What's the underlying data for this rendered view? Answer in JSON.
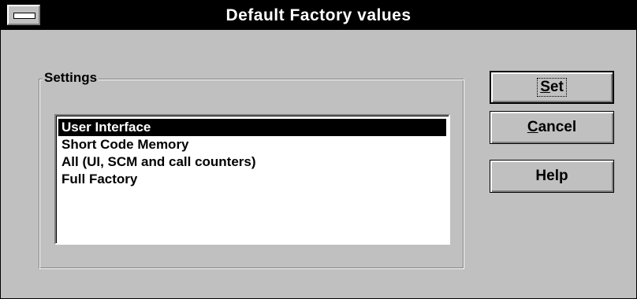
{
  "window": {
    "title": "Default Factory values"
  },
  "settings": {
    "group_label": "Settings",
    "items": [
      "User Interface",
      "Short Code Memory",
      "All (UI, SCM and call counters)",
      "Full Factory"
    ],
    "selected": "User Interface"
  },
  "buttons": {
    "set": {
      "mnemonic": "S",
      "rest": "et"
    },
    "cancel": {
      "mnemonic": "C",
      "rest": "ancel"
    },
    "help": {
      "label": "Help"
    }
  }
}
